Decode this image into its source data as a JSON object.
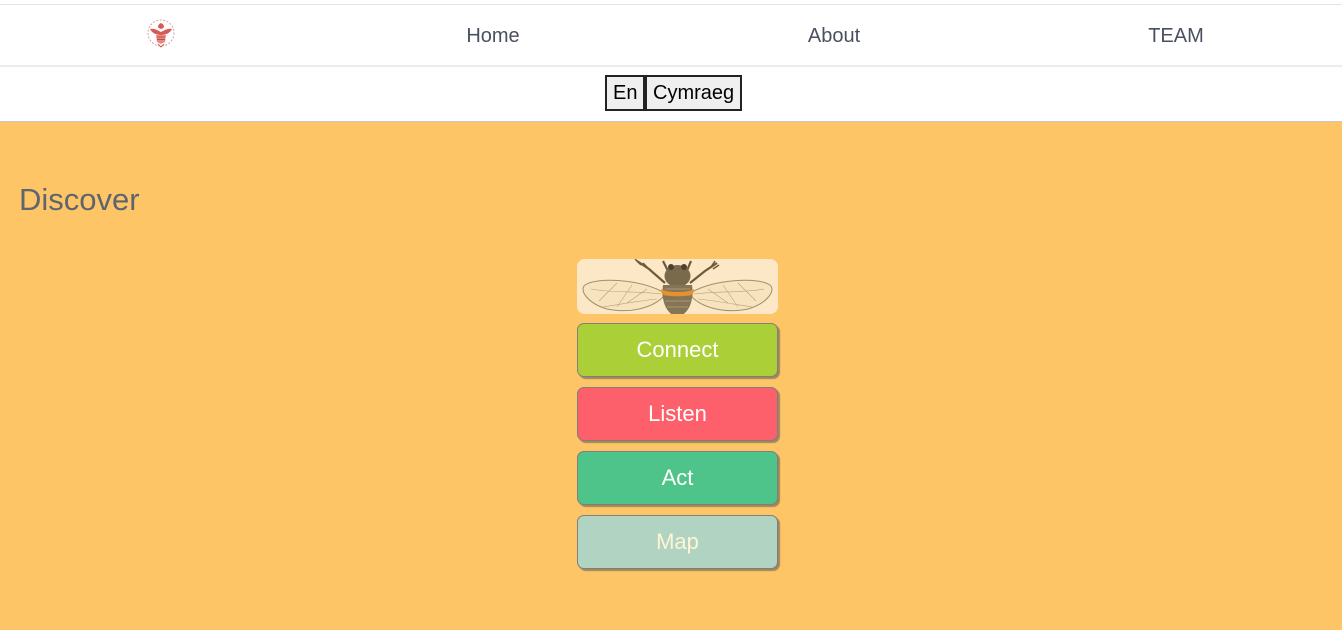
{
  "nav": {
    "logo_icon": "crest-logo-icon",
    "items": [
      {
        "label": "Home"
      },
      {
        "label": "About"
      },
      {
        "label": "TEAM"
      }
    ]
  },
  "language": {
    "en_label": "En",
    "cy_label": "Cymraeg"
  },
  "main": {
    "background_color": "#fec566",
    "heading": "Discover",
    "bee_image_icon": "bumblebee-image",
    "buttons": [
      {
        "label": "Connect",
        "color": "#aacf37",
        "text_color": "#ffffff"
      },
      {
        "label": "Listen",
        "color": "#fd5f6b",
        "text_color": "#ffffff"
      },
      {
        "label": "Act",
        "color": "#4fc48a",
        "text_color": "#ffffff"
      },
      {
        "label": "Map",
        "color": "#b0d3c2",
        "text_color": "#fff4d4"
      }
    ]
  }
}
